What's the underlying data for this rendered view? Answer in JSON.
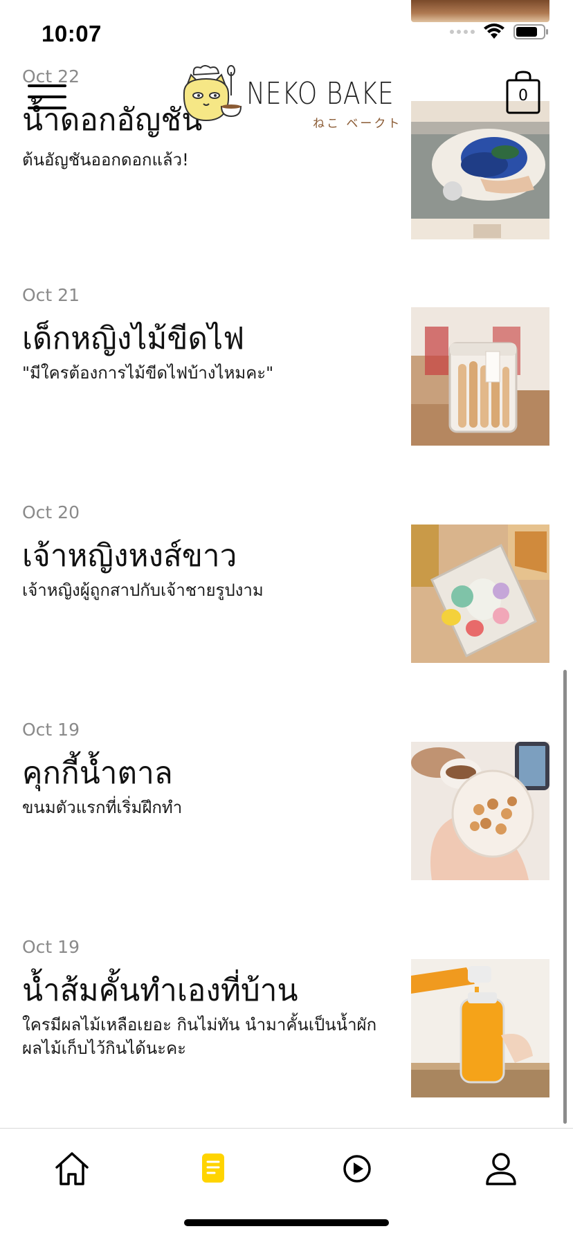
{
  "status_bar": {
    "time": "10:07",
    "icons": [
      "signal-icon",
      "wifi-icon",
      "battery-icon"
    ]
  },
  "header": {
    "brand_name": "NEKO BAKE",
    "brand_subtitle": "ねこ ベークト",
    "cart_count": "0"
  },
  "articles": [
    {
      "date": "Oct 22",
      "title": "น้ำดอกอัญชัน",
      "excerpt": "ต้นอัญชันออกดอกแล้ว!"
    },
    {
      "date": "Oct 21",
      "title": "เด็กหญิงไม้ขีดไฟ",
      "excerpt": "\"มีใครต้องการไม้ขีดไฟบ้างไหมคะ\""
    },
    {
      "date": "Oct 20",
      "title": "เจ้าหญิงหงส์ขาว",
      "excerpt": "เจ้าหญิงผู้ถูกสาปกับเจ้าชายรูปงาม"
    },
    {
      "date": "Oct 19",
      "title": "คุกกี้น้ำตาล",
      "excerpt": "ขนมตัวแรกที่เริ่มฝึกทำ"
    },
    {
      "date": "Oct 19",
      "title": "น้ำส้มคั้นทำเองที่บ้าน",
      "excerpt": "ใครมีผลไม้เหลือเยอะ กินไม่ทัน นำมาคั้นเป็นน้ำผักผลไม้เก็บไว้กินได้นะคะ"
    }
  ],
  "tab_bar": {
    "tabs": [
      {
        "icon": "home-icon",
        "active": false
      },
      {
        "icon": "blog-icon",
        "active": true
      },
      {
        "icon": "play-icon",
        "active": false
      },
      {
        "icon": "profile-icon",
        "active": false
      }
    ]
  },
  "colors": {
    "accent": "#FFD400",
    "text": "#111111",
    "date": "#8A8A8A",
    "divider": "#D8D8D8"
  }
}
